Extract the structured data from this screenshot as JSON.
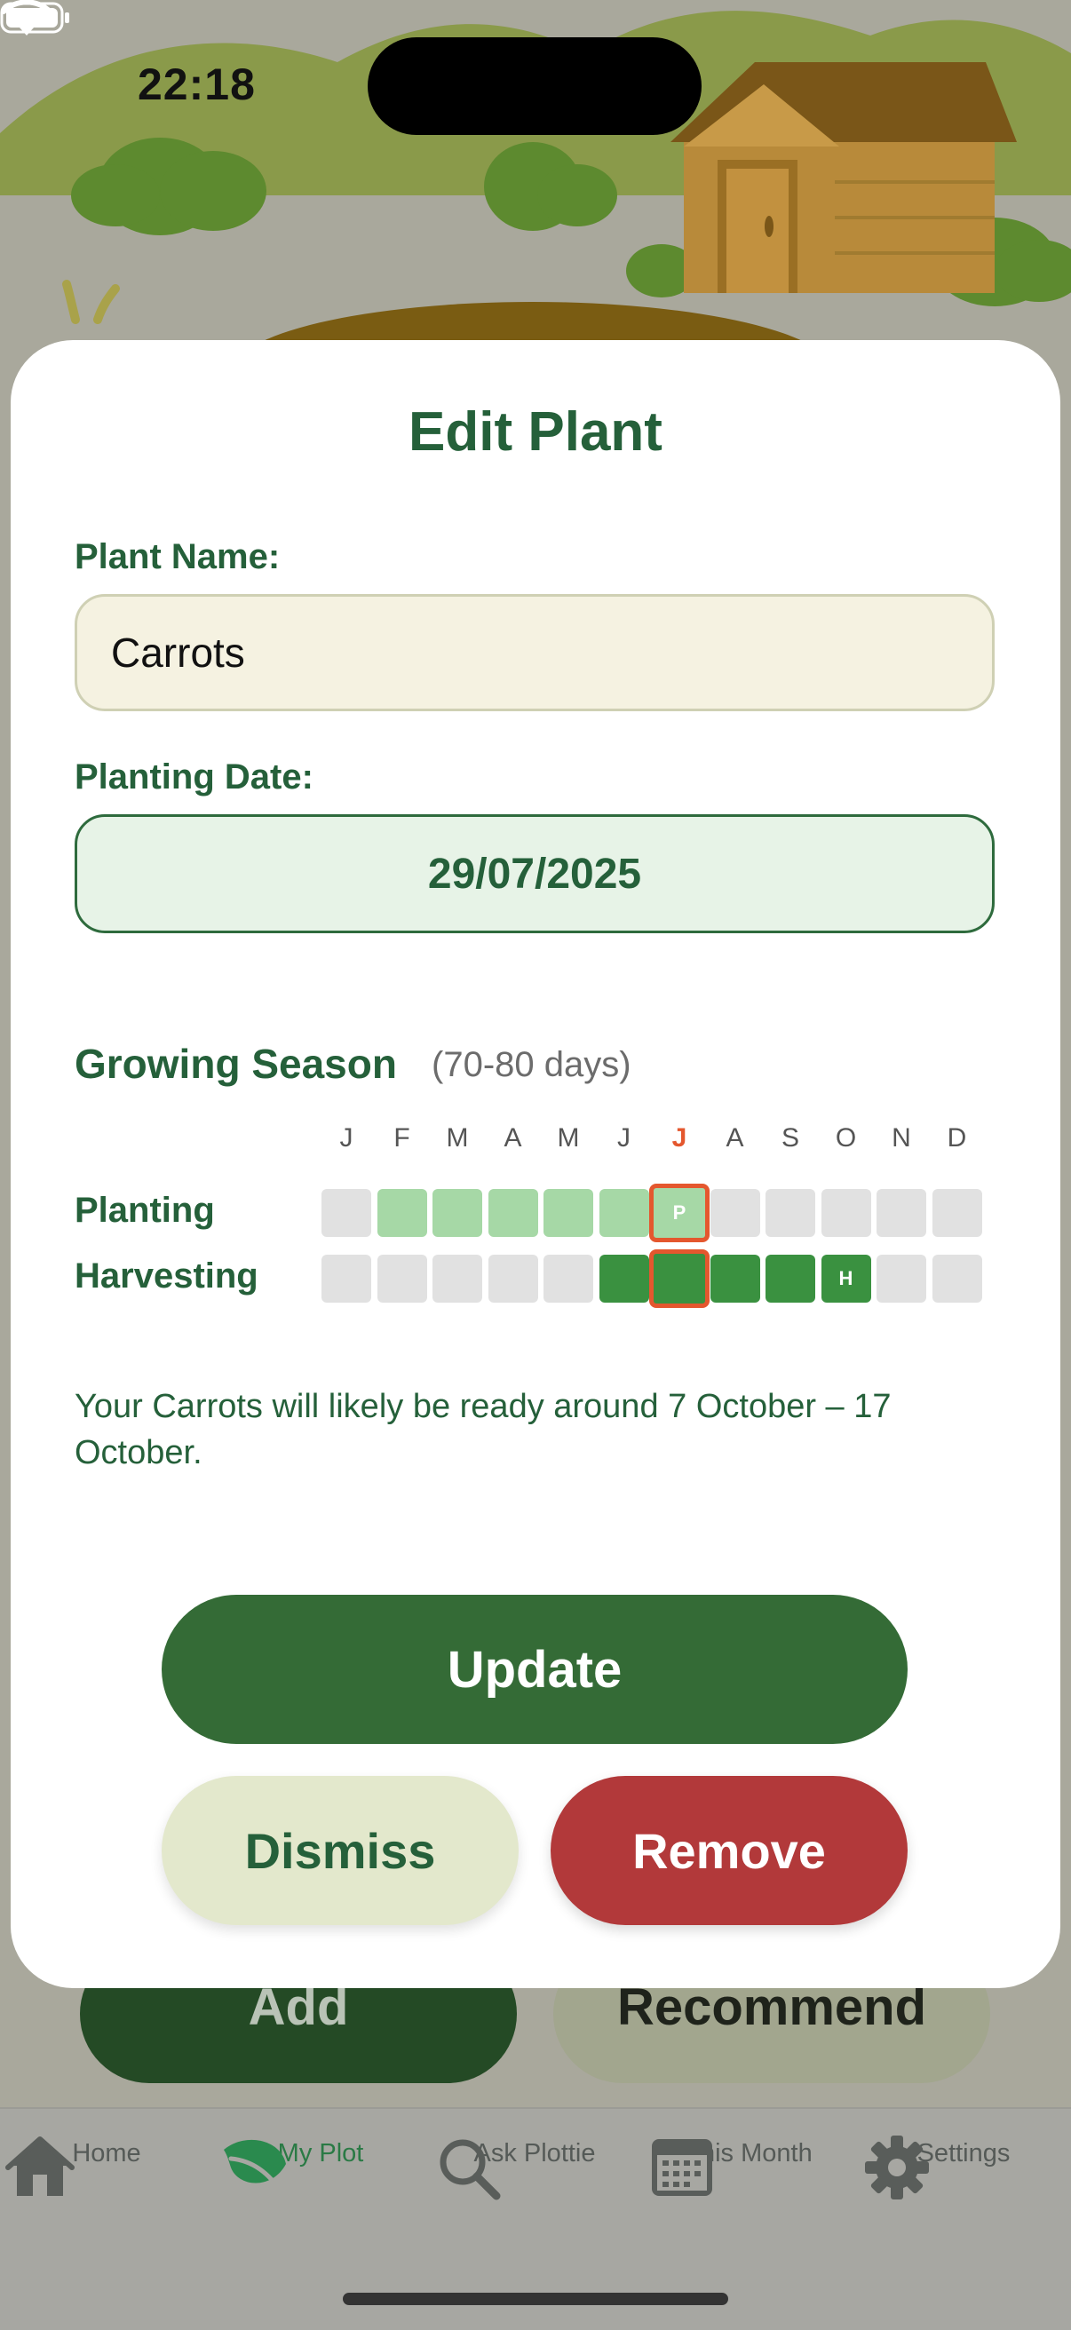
{
  "status_bar": {
    "time": "22:18"
  },
  "colors": {
    "brand_green": "#25603a",
    "update_button": "#346b36",
    "remove_button": "#b2393a",
    "dismiss_button": "#e3e8cc",
    "current_month": "#e4572e",
    "planting_cell": "#a6d8a6",
    "harvest_cell": "#3a9140"
  },
  "sheet": {
    "title": "Edit Plant",
    "plant_name_label": "Plant Name:",
    "plant_name_value": "Carrots",
    "planting_date_label": "Planting Date:",
    "planting_date_value": "29/07/2025",
    "growing_season_heading": "Growing Season",
    "growing_season_duration": "(70-80 days)",
    "months": [
      "J",
      "F",
      "M",
      "A",
      "M",
      "J",
      "J",
      "A",
      "S",
      "O",
      "N",
      "D"
    ],
    "current_month_index": 6,
    "planting_row_label": "Planting",
    "harvesting_row_label": "Harvesting",
    "planting_months": [
      false,
      true,
      true,
      true,
      true,
      true,
      true,
      false,
      false,
      false,
      false,
      false
    ],
    "harvesting_months": [
      false,
      false,
      false,
      false,
      false,
      true,
      true,
      true,
      true,
      true,
      false,
      false
    ],
    "planting_marker": {
      "month_index": 6,
      "label": "P"
    },
    "harvest_marker": {
      "month_index": 9,
      "label": "H"
    },
    "ready_text": "Your Carrots will likely be ready around 7 October – 17 October.",
    "update_label": "Update",
    "dismiss_label": "Dismiss",
    "remove_label": "Remove"
  },
  "background_buttons": {
    "add_label": "Add",
    "recommend_label": "Recommend"
  },
  "tab_bar": {
    "tabs": [
      {
        "label": "Home",
        "icon": "house-icon",
        "active": false
      },
      {
        "label": "My Plot",
        "icon": "leaf-icon",
        "active": true
      },
      {
        "label": "Ask Plottie",
        "icon": "magnifier-icon",
        "active": false
      },
      {
        "label": "This Month",
        "icon": "calendar-icon",
        "active": false
      },
      {
        "label": "Settings",
        "icon": "gear-icon",
        "active": false
      }
    ]
  }
}
